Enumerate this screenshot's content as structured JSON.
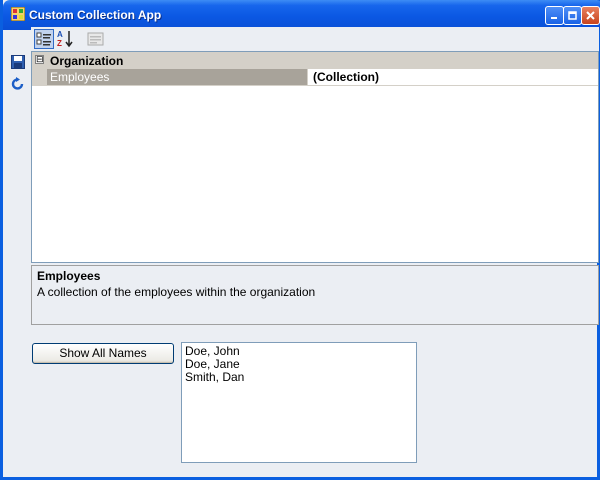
{
  "window": {
    "title": "Custom Collection App"
  },
  "toolbar": {
    "categorized_icon": "categorized-icon",
    "alphabetical_icon": "alphabetical-icon",
    "property_pages_icon": "property-pages-icon"
  },
  "side_toolbar": {
    "save_icon": "save-icon",
    "refresh_icon": "refresh-icon"
  },
  "property_grid": {
    "category": {
      "label": "Organization",
      "toggle": "⊟"
    },
    "properties": [
      {
        "name": "Employees",
        "value": "(Collection)"
      }
    ]
  },
  "help_panel": {
    "title": "Employees",
    "description": "A collection of the employees within the organization"
  },
  "actions": {
    "show_all_names": "Show All Names"
  },
  "names_list": {
    "items": [
      "Doe, John",
      "Doe, Jane",
      "Smith, Dan"
    ]
  },
  "colors": {
    "titlebar": "#0a58e3",
    "window_bg": "#ebeef3",
    "category_bg": "#d4d0c8",
    "selected_name_bg": "#a8a39a"
  }
}
